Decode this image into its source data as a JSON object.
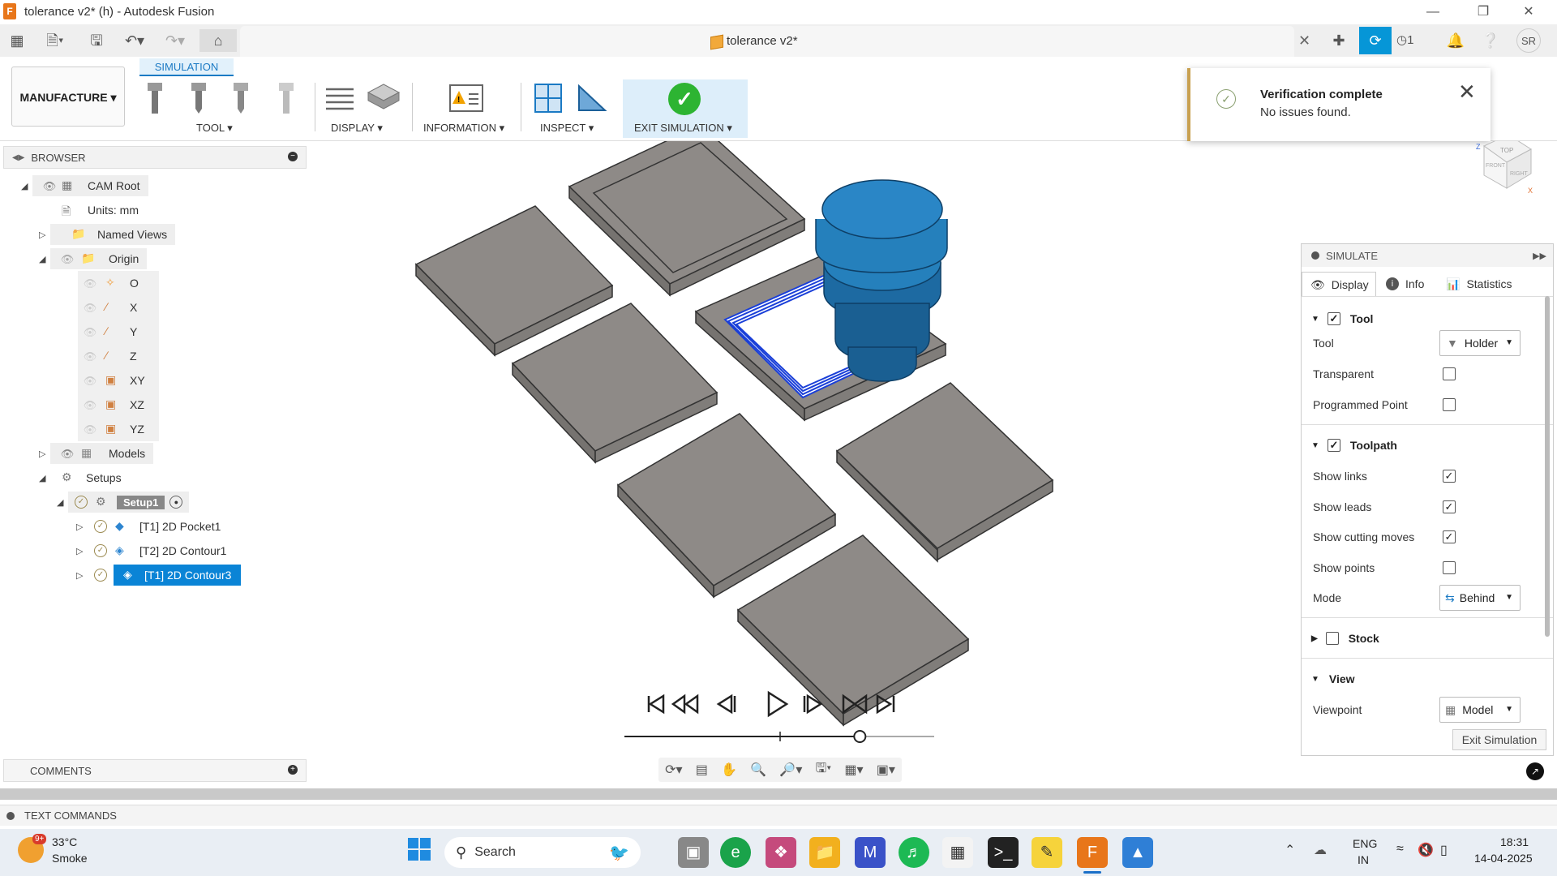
{
  "window": {
    "title": "tolerance v2* (h) - Autodesk Fusion",
    "logo_letter": "F"
  },
  "doc_tab": {
    "name": "tolerance v2*"
  },
  "top_right": {
    "jobs_count": "1",
    "user_initials": "SR"
  },
  "workspace": {
    "label": "MANUFACTURE"
  },
  "ribbon": {
    "active_tab": "SIMULATION",
    "groups": {
      "tool": "TOOL",
      "display": "DISPLAY",
      "information": "INFORMATION",
      "inspect": "INSPECT",
      "exit": "EXIT SIMULATION"
    }
  },
  "toast": {
    "title": "Verification complete",
    "message": "No issues found."
  },
  "browser": {
    "title": "BROWSER",
    "root": "CAM Root",
    "units": "Units: mm",
    "named_views": "Named Views",
    "origin": "Origin",
    "origin_items": [
      "O",
      "X",
      "Y",
      "Z",
      "XY",
      "XZ",
      "YZ"
    ],
    "models": "Models",
    "setups": "Setups",
    "setup1": "Setup1",
    "operations": [
      "[T1] 2D Pocket1",
      "[T2] 2D Contour1",
      "[T1] 2D Contour3"
    ]
  },
  "comments_label": "COMMENTS",
  "text_commands_label": "TEXT COMMANDS",
  "playback": {
    "progress": 0.76
  },
  "simulate": {
    "title": "SIMULATE",
    "tabs": [
      "Display",
      "Info",
      "Statistics"
    ],
    "tool_section": {
      "label": "Tool",
      "enabled": true,
      "rows": {
        "tool_label": "Tool",
        "tool_value": "Holder",
        "transparent": "Transparent",
        "programmed_point": "Programmed Point"
      }
    },
    "toolpath_section": {
      "label": "Toolpath",
      "enabled": true,
      "rows": {
        "show_links": "Show links",
        "show_leads": "Show leads",
        "show_cutting": "Show cutting moves",
        "show_points": "Show points",
        "mode_label": "Mode",
        "mode_value": "Behind"
      }
    },
    "stock_section": {
      "label": "Stock"
    },
    "view_section": {
      "label": "View",
      "viewpoint_label": "Viewpoint",
      "viewpoint_value": "Model"
    },
    "exit_button": "Exit Simulation"
  },
  "viewcube": {
    "top": "TOP",
    "front": "FRONT",
    "right": "RIGHT"
  },
  "taskbar": {
    "weather_temp": "33°C",
    "weather_desc": "Smoke",
    "weather_badge": "9+",
    "search": "Search",
    "lang_top": "ENG",
    "lang_bottom": "IN",
    "time": "18:31",
    "date": "14-04-2025"
  },
  "colors": {
    "accent": "#0696d7",
    "selection": "#0a84d6",
    "success": "#2db432",
    "tool_blue": "#1f6fa8"
  }
}
